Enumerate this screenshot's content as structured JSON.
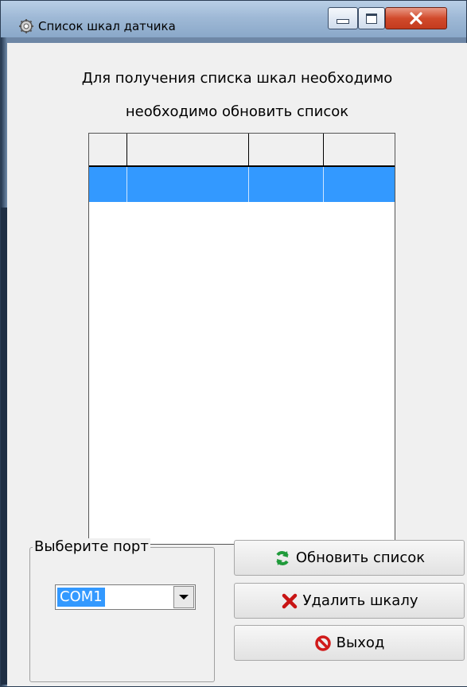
{
  "window": {
    "title": "Список шкал датчика"
  },
  "message": {
    "line1": "Для получения списка шкал необходимо",
    "line2": "необходимо обновить список"
  },
  "port_group": {
    "label": "Выберите порт",
    "selected": "COM1"
  },
  "buttons": {
    "refresh": "Обновить список",
    "delete": "Удалить шкалу",
    "exit": "Выход"
  },
  "icons": {
    "window": "gear-icon",
    "refresh": "refresh-icon",
    "delete": "red-x-icon",
    "exit": "no-entry-icon"
  },
  "colors": {
    "selection": "#3399ff",
    "refresh_icon": "#1f9a3a",
    "delete_icon": "#c81414",
    "exit_icon": "#d01a1a"
  }
}
